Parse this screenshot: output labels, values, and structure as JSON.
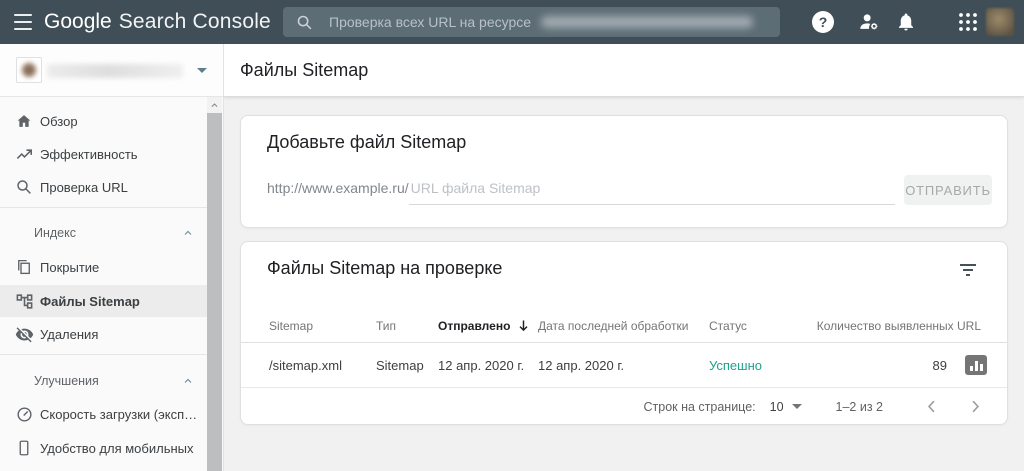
{
  "topbar": {
    "logo_part1": "Google",
    "logo_part2": "Search Console",
    "search_placeholder": "Проверка всех URL на ресурсе"
  },
  "icons": {
    "help_glyph": "?"
  },
  "sidebar": {
    "items": [
      {
        "label": "Обзор"
      },
      {
        "label": "Эффективность"
      },
      {
        "label": "Проверка URL"
      },
      {
        "label": "Покрытие"
      },
      {
        "label": "Файлы Sitemap"
      },
      {
        "label": "Удаления"
      },
      {
        "label": "Скорость загрузки (экспер…"
      },
      {
        "label": "Удобство для мобильных"
      }
    ],
    "sections": [
      {
        "label": "Индекс"
      },
      {
        "label": "Улучшения"
      }
    ]
  },
  "header": {
    "title": "Файлы Sitemap"
  },
  "add_card": {
    "title": "Добавьте файл Sitemap",
    "url_prefix": "http://www.example.ru/",
    "input_placeholder": "URL файла Sitemap",
    "submit_label": "ОТПРАВИТЬ"
  },
  "table_card": {
    "title": "Файлы Sitemap на проверке",
    "headers": [
      "Sitemap",
      "Тип",
      "Отправлено",
      "Дата последней обработки",
      "Статус",
      "Количество выявленных URL"
    ],
    "rows": [
      {
        "sitemap": "/sitemap.xml",
        "type": "Sitemap",
        "submitted": "12 апр. 2020 г.",
        "last_processed": "12 апр. 2020 г.",
        "status": "Успешно",
        "discovered_urls": "89"
      }
    ],
    "pagination": {
      "rows_per_page_label": "Строк на странице:",
      "rows_per_page_value": "10",
      "range_label": "1–2 из 2"
    }
  },
  "colors": {
    "topbar_bg": "#3f4e57",
    "status_success": "#21a18c",
    "selected_item_bg": "#ececec"
  }
}
